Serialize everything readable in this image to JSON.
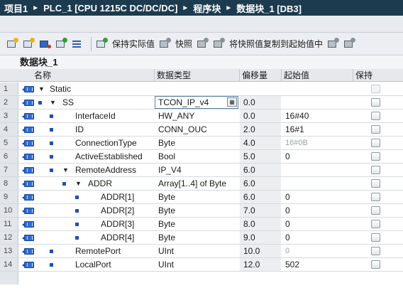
{
  "breadcrumb": [
    {
      "label": "项目1"
    },
    {
      "label": "PLC_1 [CPU 1215C DC/DC/DC]"
    },
    {
      "label": "程序块"
    },
    {
      "label": "数据块_1 [DB3]"
    }
  ],
  "toolbar": {
    "keep_actual_label": "保持实际值",
    "snapshot_label": "快照",
    "copy_snapshot_label": "将快照值复制到起始值中"
  },
  "block_title": "数据块_1",
  "columns": {
    "name": "名称",
    "datatype": "数据类型",
    "offset": "偏移量",
    "start_value": "起始值",
    "retain": "保持"
  },
  "rows": [
    {
      "num": "1",
      "name": "Static",
      "type": "",
      "offset": "",
      "start": ""
    },
    {
      "num": "2",
      "name": "SS",
      "type": "TCON_IP_v4",
      "offset": "0.0",
      "start": ""
    },
    {
      "num": "3",
      "name": "InterfaceId",
      "type": "HW_ANY",
      "offset": "0.0",
      "start": "16#40"
    },
    {
      "num": "4",
      "name": "ID",
      "type": "CONN_OUC",
      "offset": "2.0",
      "start": "16#1"
    },
    {
      "num": "5",
      "name": "ConnectionType",
      "type": "Byte",
      "offset": "4.0",
      "start": "16#0B"
    },
    {
      "num": "6",
      "name": "ActiveEstablished",
      "type": "Bool",
      "offset": "5.0",
      "start": "0"
    },
    {
      "num": "7",
      "name": "RemoteAddress",
      "type": "IP_V4",
      "offset": "6.0",
      "start": ""
    },
    {
      "num": "8",
      "name": "ADDR",
      "type": "Array[1..4] of Byte",
      "offset": "6.0",
      "start": ""
    },
    {
      "num": "9",
      "name": "ADDR[1]",
      "type": "Byte",
      "offset": "6.0",
      "start": "0"
    },
    {
      "num": "10",
      "name": "ADDR[2]",
      "type": "Byte",
      "offset": "7.0",
      "start": "0"
    },
    {
      "num": "11",
      "name": "ADDR[3]",
      "type": "Byte",
      "offset": "8.0",
      "start": "0"
    },
    {
      "num": "12",
      "name": "ADDR[4]",
      "type": "Byte",
      "offset": "9.0",
      "start": "0"
    },
    {
      "num": "13",
      "name": "RemotePort",
      "type": "UInt",
      "offset": "10.0",
      "start": "0"
    },
    {
      "num": "14",
      "name": "LocalPort",
      "type": "UInt",
      "offset": "12.0",
      "start": "502"
    }
  ]
}
